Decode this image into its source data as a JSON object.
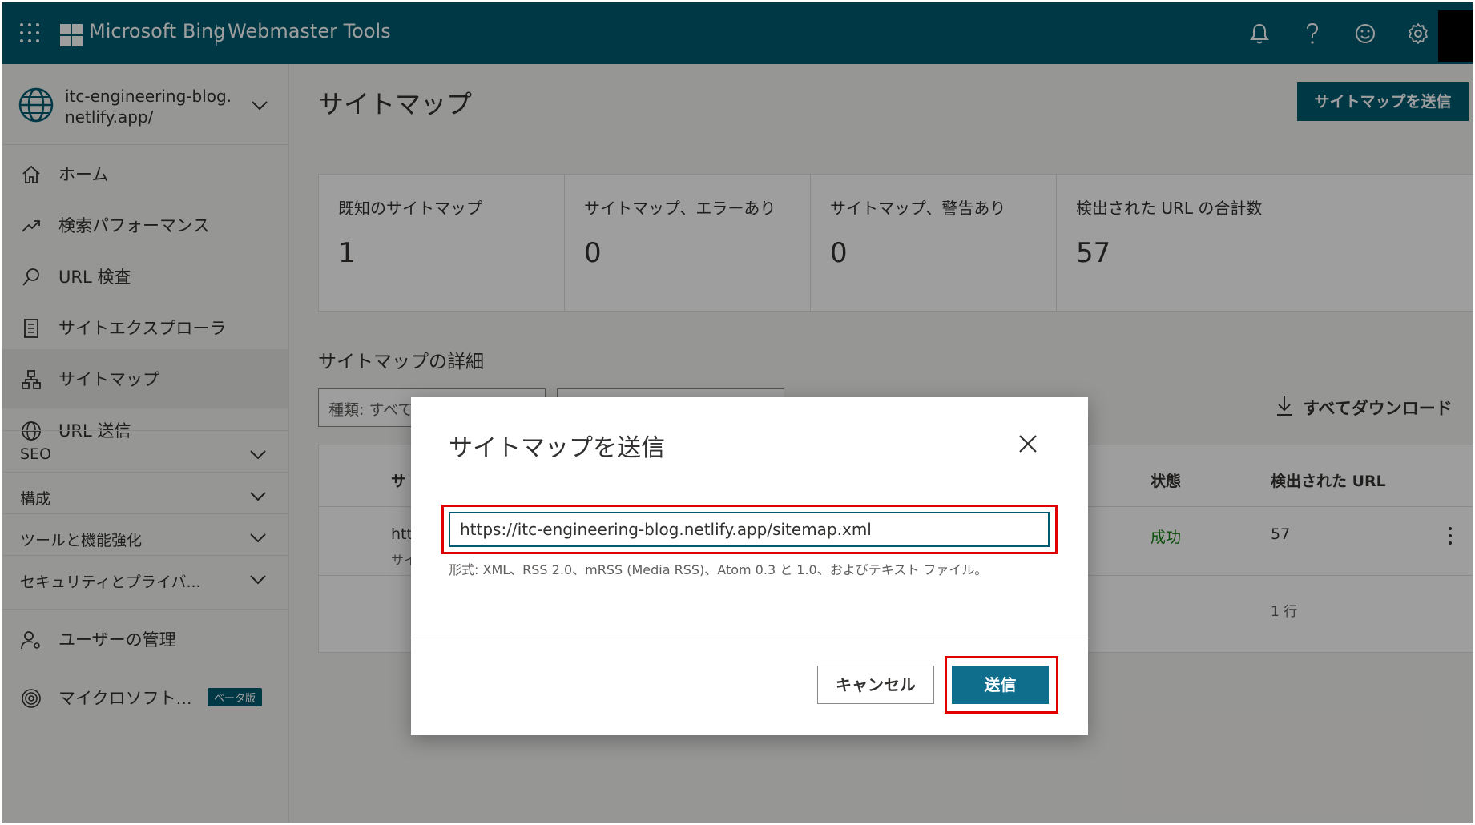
{
  "topbar": {
    "brand": "Microsoft Bing",
    "product": "Webmaster Tools",
    "icons": [
      "waffle-icon",
      "bell-icon",
      "help-icon",
      "smiley-icon",
      "gear-icon"
    ],
    "color": "#005b70"
  },
  "sidebar": {
    "site_url": "itc-engineering-blog.netlify.app/",
    "items": [
      {
        "label": "ホーム",
        "icon": "home-icon"
      },
      {
        "label": "検索パフォーマンス",
        "icon": "trend-icon"
      },
      {
        "label": "URL 検査",
        "icon": "search-icon"
      },
      {
        "label": "サイトエクスプローラ",
        "icon": "document-icon"
      },
      {
        "label": "サイトマップ",
        "icon": "sitemap-icon",
        "active": true
      },
      {
        "label": "URL 送信",
        "icon": "globe-icon"
      }
    ],
    "groups": [
      {
        "label": "SEO"
      },
      {
        "label": "構成"
      },
      {
        "label": "ツールと機能強化"
      },
      {
        "label": "セキュリティとプライバ..."
      }
    ],
    "bottom_items": [
      {
        "label": "ユーザーの管理",
        "icon": "user-settings-icon"
      },
      {
        "label": "マイクロソフト...",
        "icon": "fingerprint-icon",
        "badge": "ベータ版"
      }
    ]
  },
  "main": {
    "title": "サイトマップ",
    "submit_button": "サイトマップを送信",
    "stats": [
      {
        "label": "既知のサイトマップ",
        "value": "1"
      },
      {
        "label": "サイトマップ、エラーあり",
        "value": "0"
      },
      {
        "label": "サイトマップ、警告あり",
        "value": "0"
      },
      {
        "label": "検出された URL の合計数",
        "value": "57"
      }
    ],
    "details_title": "サイトマップの詳細",
    "filter_type": "種類: すべて",
    "download_all": "すべてダウンロード",
    "table": {
      "headers": [
        "サ",
        "状態",
        "検出された URL"
      ],
      "row": {
        "url_fragment": "htt",
        "sub_fragment": "サイ",
        "status": "成功",
        "count": "57"
      },
      "row_count": "1 行"
    }
  },
  "modal": {
    "title": "サイトマップを送信",
    "url_value": "https://itc-engineering-blog.netlify.app/sitemap.xml",
    "format_hint": "形式: XML、RSS 2.0、mRSS (Media RSS)、Atom 0.3 と 1.0、およびテキスト ファイル。",
    "cancel_label": "キャンセル",
    "send_label": "送信",
    "highlight_color": "#e00000",
    "accent_color": "#0f6e8c"
  }
}
